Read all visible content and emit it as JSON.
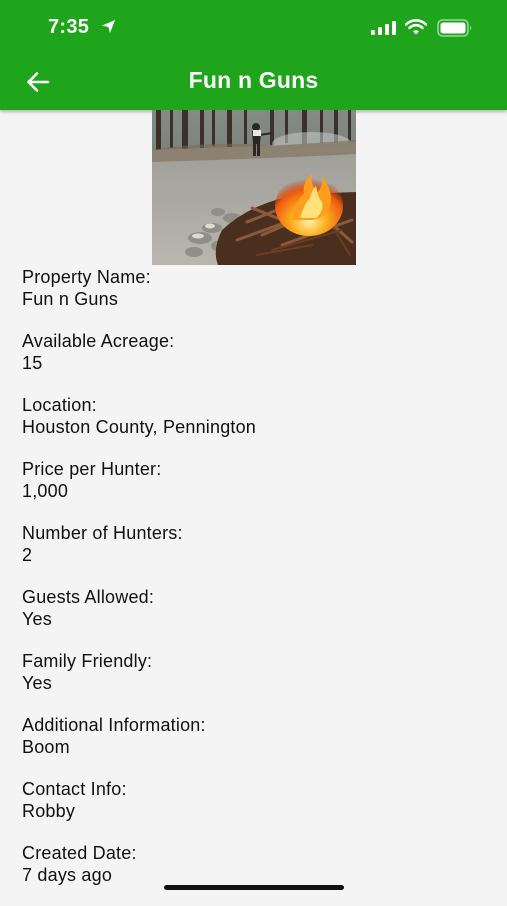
{
  "status_bar": {
    "time": "7:35"
  },
  "header": {
    "title": "Fun n Guns",
    "background": "#1fa51c"
  },
  "photo": {
    "subject": "campfire-with-person-in-woods"
  },
  "fields": [
    {
      "label": "Property Name:",
      "value": "Fun n Guns"
    },
    {
      "label": "Available Acreage:",
      "value": "15"
    },
    {
      "label": "Location:",
      "value": "Houston County, Pennington"
    },
    {
      "label": "Price per Hunter:",
      "value": "1,000"
    },
    {
      "label": "Number of Hunters:",
      "value": "2"
    },
    {
      "label": "Guests Allowed:",
      "value": "Yes"
    },
    {
      "label": "Family Friendly:",
      "value": "Yes"
    },
    {
      "label": "Additional Information:",
      "value": "Boom"
    },
    {
      "label": "Contact Info:",
      "value": "Robby"
    },
    {
      "label": "Created Date:",
      "value": "7 days ago"
    }
  ]
}
